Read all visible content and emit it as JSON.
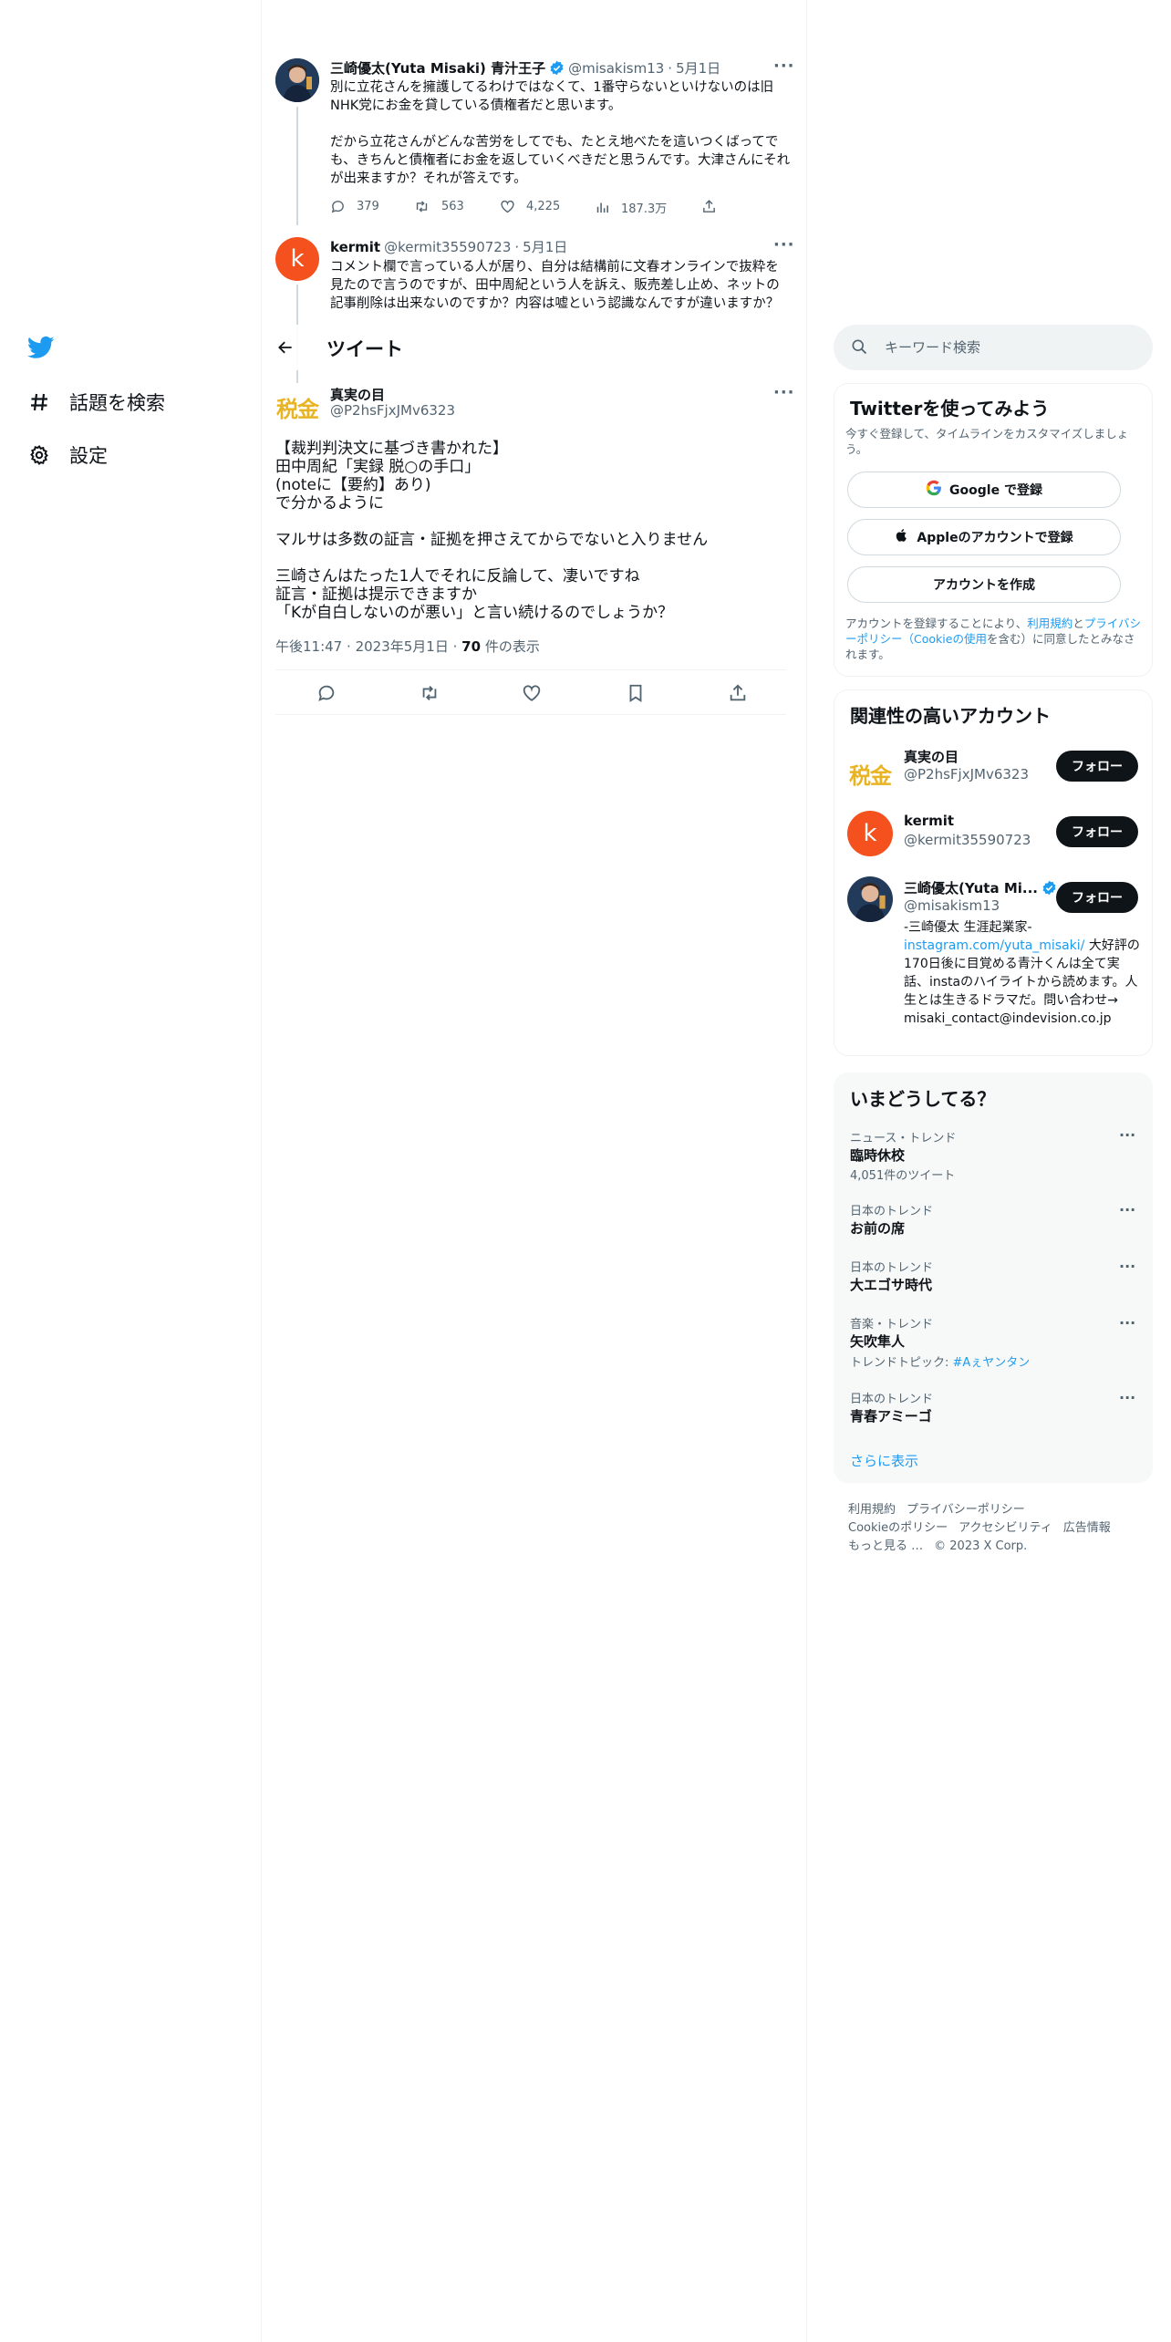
{
  "nav": {
    "logo": "twitter-bird",
    "items": [
      {
        "label": "話題を検索",
        "icon": "hashtag-icon"
      },
      {
        "label": "設定",
        "icon": "gear-icon"
      }
    ]
  },
  "thread": [
    {
      "name": "三崎優太(Yuta Misaki) 青汁王子",
      "verified": true,
      "handle": "@misakism13",
      "date": "5月1日",
      "text": "別に立花さんを擁護してるわけではなくて、1番守らないといけないのは旧NHK党にお金を貸している債権者だと思います。\n\nだから立花さんがどんな苦労をしてでも、たとえ地べたを這いつくばってでも、きちんと債権者にお金を返していくべきだと思うんです。大津さんにそれが出来ますか？それが答えです。",
      "stats": {
        "replies": "379",
        "retweets": "563",
        "likes": "4,225",
        "views": "187.3万"
      }
    },
    {
      "name": "kermit",
      "avatar_letter": "k",
      "handle": "@kermit35590723",
      "date": "5月1日",
      "text": "コメント欄で言っている人が居り、自分は結構前に文春オンラインで抜粋を見たので言うのですが、田中周紀という人を訴え、販売差し止め、ネットの記事削除は出来ないのですか？内容は嘘という認識なんですが違いますか？"
    }
  ],
  "header": {
    "title": "ツイート"
  },
  "main_tweet": {
    "avatar_text": "税金",
    "name": "真実の目",
    "handle": "@P2hsFjxJMv6323",
    "text": "【裁判判決文に基づき書かれた】\n田中周紀「実録 脱○の手口」\n(noteに【要約】あり)\nで分かるように\n\nマルサは多数の証言・証拠を押さえてからでないと入りません\n\n三崎さんはたった1人でそれに反論して、凄いですね\n証言・証拠は提示できますか\n「Kが自白しないのが悪い」と言い続けるのでしょうか？",
    "time": "午後11:47",
    "date": "2023年5月1日",
    "views_count": "70",
    "views_label": "件の表示"
  },
  "search": {
    "placeholder": "キーワード検索"
  },
  "signup": {
    "title": "Twitterを使ってみよう",
    "subtitle": "今すぐ登録して、タイムラインをカスタマイズしましょう。",
    "google_label": "Google で登録",
    "apple_label": "Appleのアカウントで登録",
    "create_label": "アカウントを作成",
    "legal_prefix": "アカウントを登録することにより、",
    "legal_terms": "利用規約",
    "legal_and": "と",
    "legal_privacy": "プライバシーポリシー",
    "legal_cookie": "（Cookieの使用",
    "legal_suffix": "を含む）に同意したとみなされます。"
  },
  "related": {
    "title": "関連性の高いアカウント",
    "follow_label": "フォロー",
    "accounts": [
      {
        "name": "真実の目",
        "handle": "@P2hsFjxJMv6323",
        "avatar_text": "税金"
      },
      {
        "name": "kermit",
        "handle": "@kermit35590723",
        "avatar_letter": "k"
      },
      {
        "name": "三崎優太(Yuta Mi...",
        "handle": "@misakism13",
        "verified": true,
        "bio_line1": "-三崎優太 生涯起業家-",
        "bio_link": "instagram.com/yuta_misaki/",
        "bio_rest": " 大好評の170日後に目覚める青汁くんは全て実話、instaのハイライトから読めます。人生とは生きるドラマだ。問い合わせ→",
        "bio_email": "misaki_contact@indevision.co.jp"
      }
    ]
  },
  "trends": {
    "title": "いまどうしてる？",
    "items": [
      {
        "category": "ニュース・トレンド",
        "name": "臨時休校",
        "sub": "4,051件のツイート"
      },
      {
        "category": "日本のトレンド",
        "name": "お前の席",
        "sub": ""
      },
      {
        "category": "日本のトレンド",
        "name": "大エゴサ時代",
        "sub": ""
      },
      {
        "category": "音楽・トレンド",
        "name": "矢吹隼人",
        "sub": "トレンドトピック: ",
        "sub_link": "#Aぇヤンタン"
      },
      {
        "category": "日本のトレンド",
        "name": "青春アミーゴ",
        "sub": ""
      }
    ],
    "show_more": "さらに表示"
  },
  "footer": {
    "row1": [
      "利用規約",
      "プライバシーポリシー"
    ],
    "row2": [
      "Cookieのポリシー",
      "アクセシビリティ",
      "広告情報"
    ],
    "more": "もっと見る …",
    "copyright": "© 2023 X Corp."
  },
  "colors": {
    "accent": "#1d9bf0",
    "text": "#0f1419",
    "muted": "#536471",
    "kermit": "#f4511e",
    "gold": "#e8b423"
  }
}
